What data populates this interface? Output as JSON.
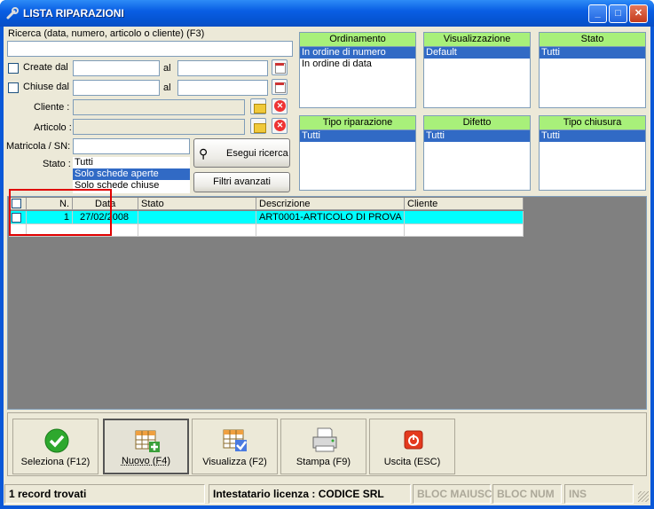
{
  "window": {
    "title": "LISTA RIPARAZIONI"
  },
  "search": {
    "label": "Ricerca (data, numero, articolo o cliente) (F3)",
    "value": ""
  },
  "filters": {
    "create_label": "Create dal",
    "chiuse_label": "Chiuse dal",
    "al_label": "al",
    "cliente_label": "Cliente :",
    "articolo_label": "Articolo :",
    "matricola_label": "Matricola / SN:",
    "stato_label": "Stato :",
    "stato_options": [
      "Tutti",
      "Solo schede aperte",
      "Solo schede chiuse"
    ],
    "stato_selected": 1
  },
  "buttons": {
    "esegui": "Esegui ricerca",
    "filtri": "Filtri avanzati"
  },
  "panels": {
    "ordinamento": {
      "title": "Ordinamento",
      "items": [
        "In ordine di numero",
        "In ordine di data"
      ],
      "selected": 0
    },
    "visualizzazione": {
      "title": "Visualizzazione",
      "items": [
        "Default"
      ],
      "selected": 0
    },
    "stato": {
      "title": "Stato",
      "items": [
        "Tutti"
      ],
      "selected": 0
    },
    "tipo_riparazione": {
      "title": "Tipo riparazione",
      "items": [
        "Tutti"
      ],
      "selected": 0
    },
    "difetto": {
      "title": "Difetto",
      "items": [
        "Tutti"
      ],
      "selected": 0
    },
    "tipo_chiusura": {
      "title": "Tipo chiusura",
      "items": [
        "Tutti"
      ],
      "selected": 0
    }
  },
  "grid": {
    "columns": [
      "",
      "N.",
      "Data",
      "Stato",
      "Descrizione",
      "Cliente"
    ],
    "rows": [
      {
        "n": "1",
        "data": "27/02/2008",
        "stato": "",
        "descrizione": "ART0001-ARTICOLO DI PROVA",
        "cliente": ""
      }
    ]
  },
  "actions": {
    "seleziona": "Seleziona (F12)",
    "nuovo": "Nuovo (F4)",
    "visualizza": "Visualizza (F2)",
    "stampa": "Stampa (F9)",
    "uscita": "Uscita (ESC)"
  },
  "status": {
    "records": "1 record trovati",
    "licenza": "Intestatario licenza : CODICE SRL",
    "maiusc": "BLOC MAIUSC",
    "num": "BLOC NUM",
    "ins": "INS"
  },
  "colors": {
    "accent": "#316ac5",
    "highlight_row": "#00ffff",
    "panel_header": "#a8f07a",
    "annotation": "#e00000"
  }
}
